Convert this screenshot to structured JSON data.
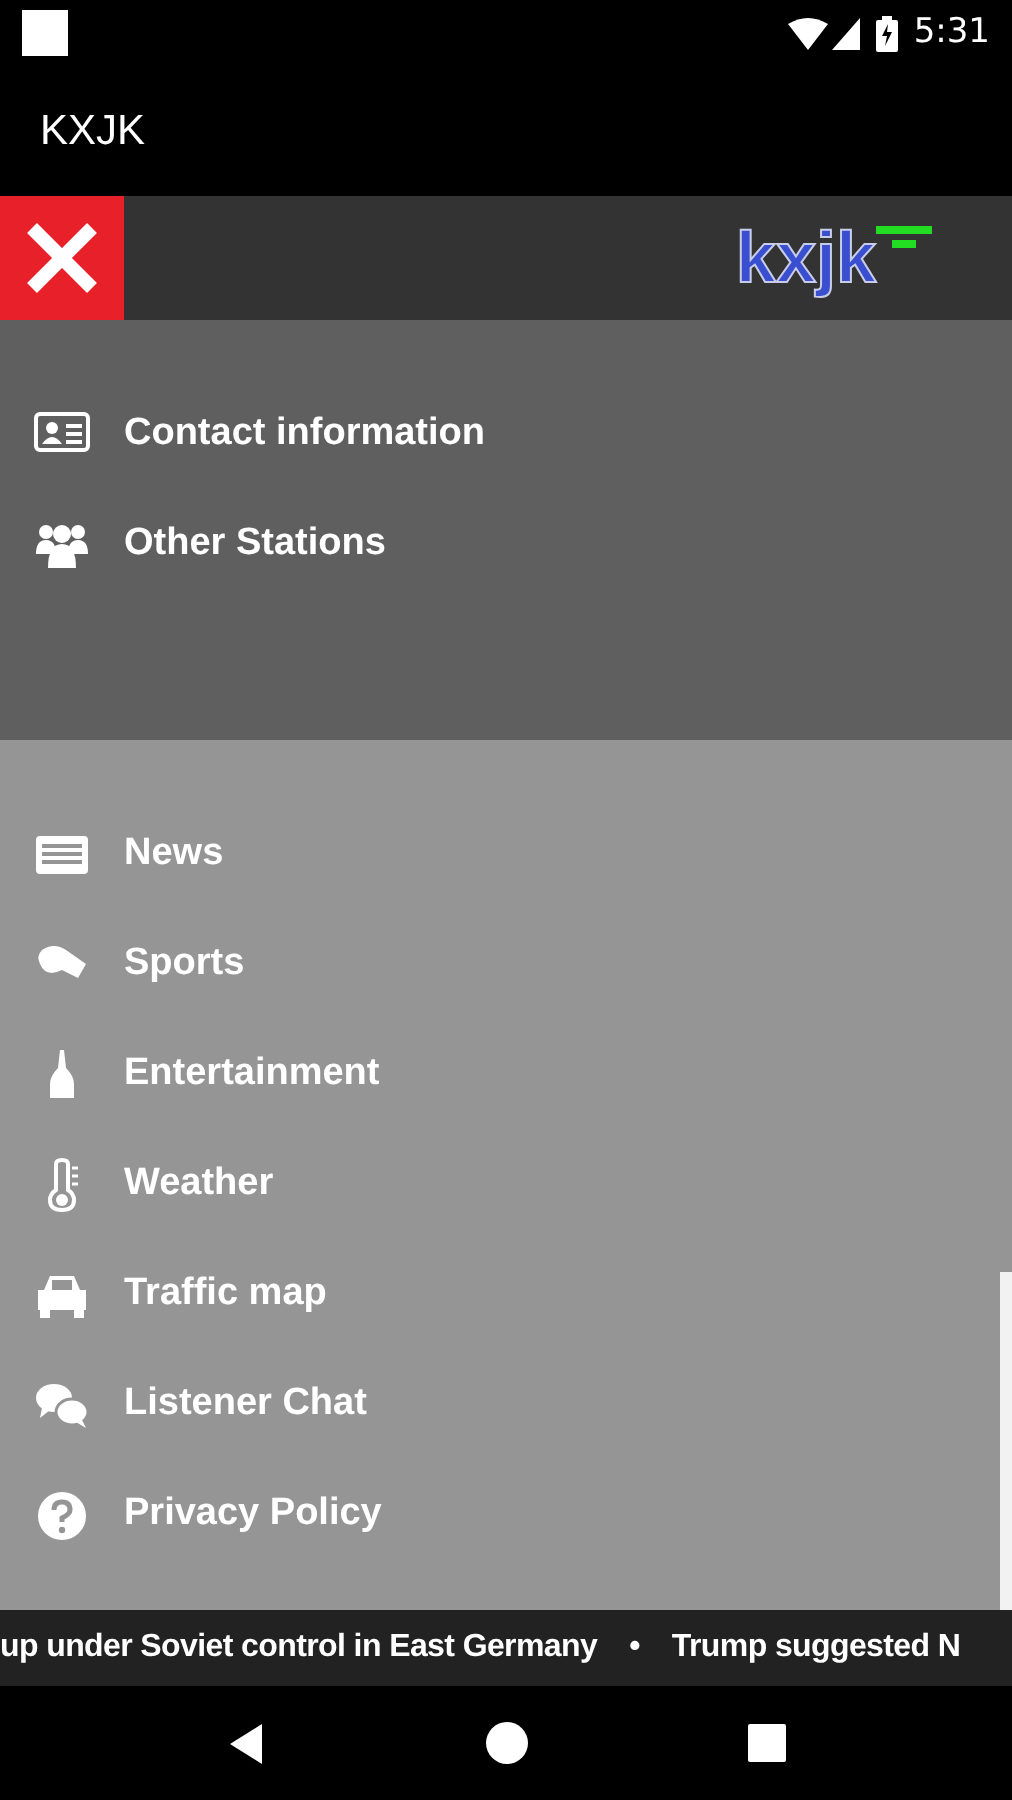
{
  "status_bar": {
    "time": "5:31"
  },
  "app_bar": {
    "title": "KXJK"
  },
  "drawer": {
    "logo_text": "kxjk",
    "top_items": [
      {
        "label": "Contact information"
      },
      {
        "label": "Other Stations"
      }
    ],
    "items": [
      {
        "label": "News"
      },
      {
        "label": "Sports"
      },
      {
        "label": "Entertainment"
      },
      {
        "label": "Weather"
      },
      {
        "label": "Traffic map"
      },
      {
        "label": "Listener Chat"
      },
      {
        "label": "Privacy Policy"
      }
    ]
  },
  "ticker": [
    "up under Soviet control in East Germany",
    "•",
    "Trump suggested N"
  ]
}
